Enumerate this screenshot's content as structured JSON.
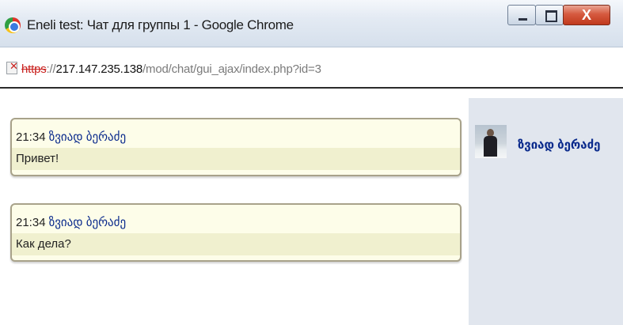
{
  "window": {
    "title": "Eneli test: Чат для группы 1 - Google Chrome",
    "close_label": "X"
  },
  "address": {
    "protocol": "https",
    "separator": "://",
    "host": "217.147.235.138",
    "path": "/mod/chat/gui_ajax/index.php?id=3"
  },
  "messages": [
    {
      "time": "21:34",
      "author": "ზვიად ბერაძე",
      "text": "Привет!"
    },
    {
      "time": "21:34",
      "author": "ზვიად ბერაძე",
      "text": "Как дела?"
    }
  ],
  "users": [
    {
      "name": "ზვიად ბერაძე",
      "avatar": "user-photo"
    }
  ],
  "colors": {
    "author": "#0a2a8c",
    "message_bg": "#fdfde9",
    "message_text_bg": "#f0f0cf",
    "users_panel_bg": "#e1e6ee",
    "insecure_https": "#c9211e"
  }
}
